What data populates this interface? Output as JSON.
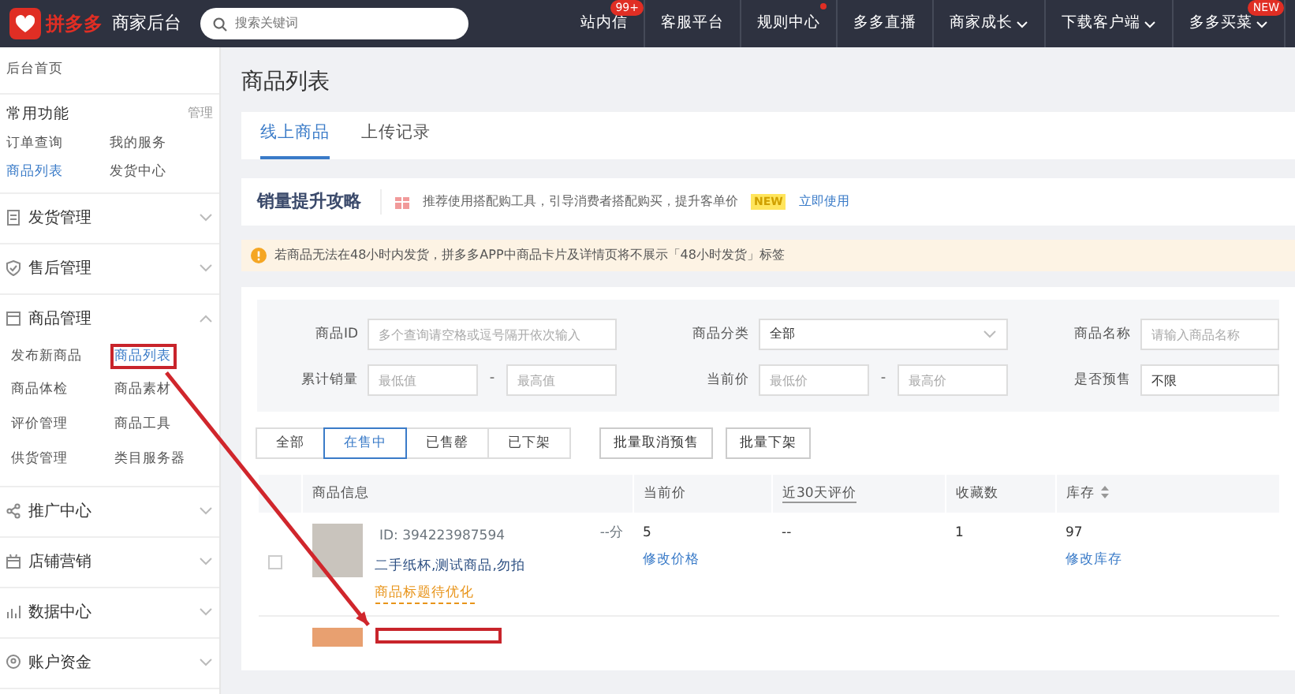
{
  "topbar": {
    "logo_text": "拼多多",
    "app_title": "商家后台",
    "search": {
      "placeholder": "搜索关键词"
    },
    "nav": [
      {
        "label": "站内信",
        "badge": "99+",
        "dot": false,
        "dropdown": false
      },
      {
        "label": "客服平台",
        "dot": false,
        "dropdown": false
      },
      {
        "label": "规则中心",
        "dot": true,
        "dropdown": false
      },
      {
        "label": "多多直播",
        "dot": false,
        "dropdown": false
      },
      {
        "label": "商家成长",
        "dot": false,
        "dropdown": true
      },
      {
        "label": "下载客户端",
        "dot": false,
        "dropdown": true
      },
      {
        "label": "多多买菜",
        "badge": "NEW",
        "dot": false,
        "dropdown": true
      }
    ]
  },
  "sidebar": {
    "home": "后台首页",
    "common": {
      "title": "常用功能",
      "manage": "管理",
      "items": [
        {
          "label": "订单查询",
          "selected": false
        },
        {
          "label": "我的服务",
          "selected": false
        },
        {
          "label": "商品列表",
          "selected": true
        },
        {
          "label": "发货中心",
          "selected": false
        }
      ]
    },
    "sections": [
      {
        "label": "发货管理",
        "kind": "doc",
        "expanded": false
      },
      {
        "label": "售后管理",
        "kind": "shield",
        "expanded": false
      },
      {
        "label": "商品管理",
        "kind": "box",
        "expanded": true,
        "children": [
          {
            "label": "发布新商品",
            "selected": false,
            "highlighted": false
          },
          {
            "label": "商品列表",
            "selected": true,
            "highlighted": true
          },
          {
            "label": "商品体检",
            "selected": false,
            "highlighted": false
          },
          {
            "label": "商品素材",
            "selected": false,
            "highlighted": false
          },
          {
            "label": "评价管理",
            "selected": false,
            "highlighted": false
          },
          {
            "label": "商品工具",
            "selected": false,
            "highlighted": false
          },
          {
            "label": "供货管理",
            "selected": false,
            "highlighted": false
          },
          {
            "label": "类目服务器",
            "selected": false,
            "highlighted": false
          }
        ]
      },
      {
        "label": "推广中心",
        "kind": "share",
        "expanded": false
      },
      {
        "label": "店铺营销",
        "kind": "shop",
        "expanded": false
      },
      {
        "label": "数据中心",
        "kind": "chart",
        "expanded": false
      },
      {
        "label": "账户资金",
        "kind": "pin",
        "expanded": false
      }
    ]
  },
  "page_title": "商品列表",
  "tabs": [
    {
      "label": "线上商品",
      "selected": true
    },
    {
      "label": "上传记录",
      "selected": false
    }
  ],
  "promo": {
    "title": "销量提升攻略",
    "text": "推荐使用搭配购工具，引导消费者搭配购买，提升客单价",
    "badge": "NEW",
    "link": "立即使用"
  },
  "notice": "若商品无法在48小时内发货，拼多多APP中商品卡片及详情页将不展示「48小时发货」标签",
  "filters": [
    {
      "label": "商品ID",
      "kind": "text",
      "placeholder": "多个查询请空格或逗号隔开依次输入"
    },
    {
      "label": "商品分类",
      "kind": "select",
      "value": "全部"
    },
    {
      "label": "商品名称",
      "kind": "text",
      "placeholder": "请输入商品名称"
    },
    {
      "label": "累计销量",
      "kind": "range",
      "placeholder_min": "最低值",
      "placeholder_max": "最高值",
      "separator": "-"
    },
    {
      "label": "当前价",
      "kind": "range",
      "placeholder_min": "最低价",
      "placeholder_max": "最高价",
      "separator": "-"
    },
    {
      "label": "是否预售",
      "kind": "text",
      "value": "不限"
    }
  ],
  "status_tabs": [
    {
      "label": "全部",
      "selected": false
    },
    {
      "label": "在售中",
      "selected": true
    },
    {
      "label": "已售罄",
      "selected": false
    },
    {
      "label": "已下架",
      "selected": false
    }
  ],
  "batch_buttons": [
    "批量取消预售",
    "批量下架"
  ],
  "table": {
    "columns": [
      {
        "label": "商品信息",
        "underlined": false,
        "sortable": false
      },
      {
        "label": "当前价",
        "underlined": false,
        "sortable": false
      },
      {
        "label": "近30天评价",
        "underlined": true,
        "sortable": false
      },
      {
        "label": "收藏数",
        "underlined": false,
        "sortable": false
      },
      {
        "label": "库存",
        "underlined": false,
        "sortable": true
      }
    ],
    "rows": [
      {
        "checked": false,
        "id": "ID: 394223987594",
        "title": "二手纸杯,测试商品,勿拍",
        "tag": "商品标题待优化",
        "score": "--分",
        "price": "5",
        "price_action": "修改价格",
        "rating": "--",
        "favorites": "1",
        "stock": "97",
        "stock_action": "修改库存",
        "highlighted": false
      },
      {
        "partial": true,
        "highlighted": true
      }
    ]
  }
}
